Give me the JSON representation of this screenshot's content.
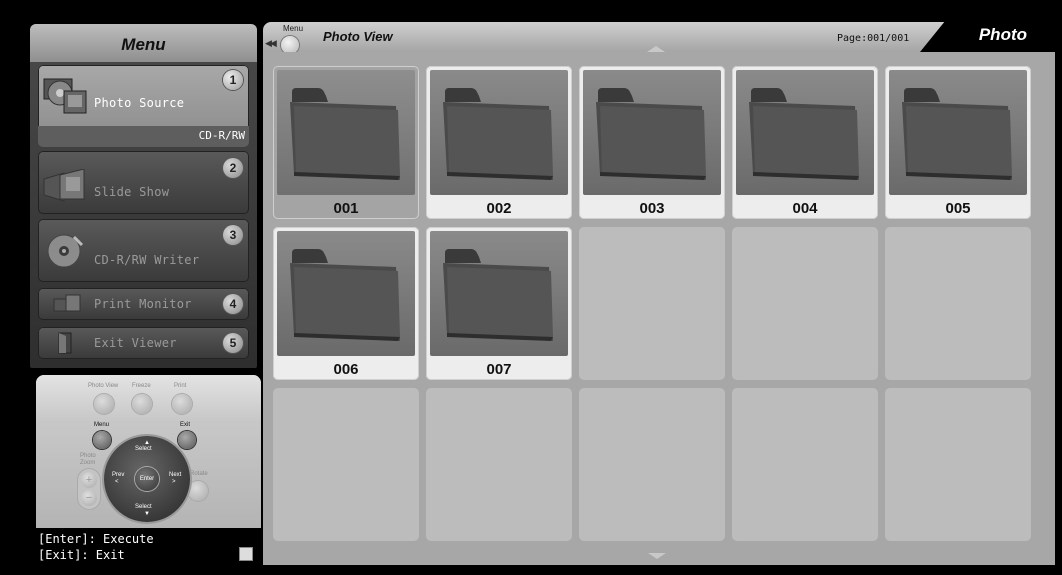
{
  "menu": {
    "title": "Menu",
    "items": [
      {
        "number": "1",
        "label": "Photo Source",
        "sub_label": "CD-R/RW",
        "icon": "photo-source-icon",
        "selected": true
      },
      {
        "number": "2",
        "label": "Slide Show",
        "icon": "slide-show-icon"
      },
      {
        "number": "3",
        "label": "CD-R/RW Writer",
        "icon": "cd-writer-icon"
      },
      {
        "number": "4",
        "label": "Print Monitor",
        "icon": "print-monitor-icon"
      },
      {
        "number": "5",
        "label": "Exit Viewer",
        "icon": "exit-door-icon"
      }
    ]
  },
  "remote": {
    "photo_view": "Photo View",
    "freeze": "Freeze",
    "print": "Print",
    "menu": "Menu",
    "exit": "Exit",
    "photo_zoom": "Photo\nZoom",
    "select_up": "Select",
    "select_down": "Select",
    "prev": "Prev",
    "next": "Next",
    "enter": "Enter",
    "rotate": "Rotate"
  },
  "help": {
    "line1": "[Enter]: Execute",
    "line2": "[Exit]: Exit"
  },
  "header": {
    "menu_small": "Menu",
    "view_title": "Photo View",
    "page_info": "Page:001/001",
    "tab_label": "Photo"
  },
  "folders": [
    {
      "label": "001",
      "selected": true
    },
    {
      "label": "002"
    },
    {
      "label": "003"
    },
    {
      "label": "004"
    },
    {
      "label": "005"
    },
    {
      "label": "006"
    },
    {
      "label": "007"
    }
  ],
  "colors": {
    "background": "#000000",
    "grid_bg": "#a7a7a7",
    "empty_cell": "#bcbcbc",
    "folder_cell": "#ededed",
    "selected_cell": "#a4a4a4"
  }
}
